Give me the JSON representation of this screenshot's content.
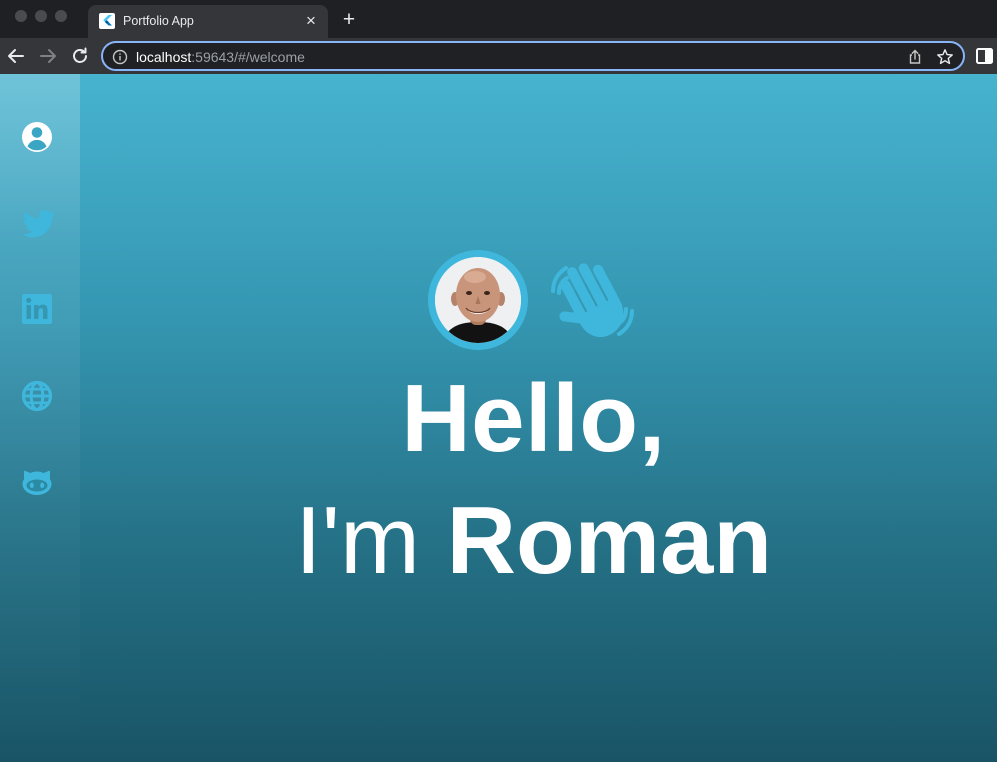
{
  "browser": {
    "tab_title": "Portfolio App",
    "tab_close": "×",
    "new_tab": "+",
    "url_host": "localhost",
    "url_rest": ":59643/#/welcome"
  },
  "sidebar": {
    "items": [
      {
        "name": "profile",
        "icon": "account-circle-icon"
      },
      {
        "name": "twitter",
        "icon": "twitter-icon"
      },
      {
        "name": "linkedin",
        "icon": "linkedin-icon"
      },
      {
        "name": "website",
        "icon": "globe-icon"
      },
      {
        "name": "github",
        "icon": "github-icon"
      }
    ]
  },
  "hero": {
    "greeting": "Hello,",
    "intro_prefix": "I'm ",
    "name": "Roman",
    "wave_icon": "waving-hand-icon"
  },
  "colors": {
    "accent": "#3fb7dc",
    "gradient_top": "#47b3cf",
    "gradient_bottom": "#195466",
    "text": "#ffffff"
  }
}
